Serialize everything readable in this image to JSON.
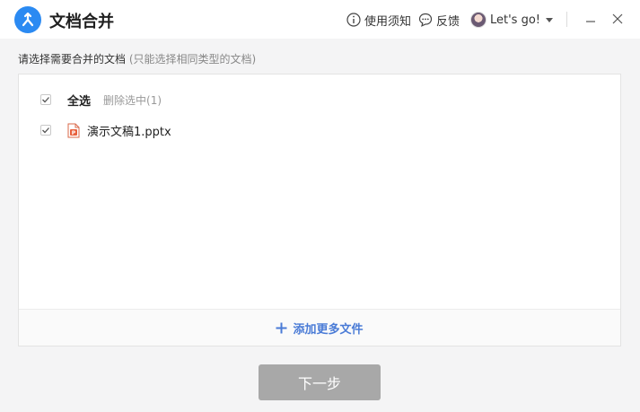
{
  "app": {
    "title": "文档合并",
    "logo_icon": "merge-arrows-icon",
    "brand_color": "#2b8af2"
  },
  "titlebar": {
    "help_label": "使用须知",
    "help_icon": "info-circle-icon",
    "feedback_label": "反馈",
    "feedback_icon": "chat-bubble-icon",
    "user_name": "Let's go!",
    "minimize_icon": "minimize-icon",
    "close_icon": "close-icon"
  },
  "instruction": {
    "text": "请选择需要合并的文档",
    "hint": "(只能选择相同类型的文档)"
  },
  "file_list": {
    "select_all_label": "全选",
    "select_all_checked": true,
    "delete_selected_label": "删除选中(1)",
    "files": [
      {
        "name": "演示文稿1.pptx",
        "checked": true,
        "icon": "powerpoint-file-icon"
      }
    ],
    "add_more_label": "添加更多文件",
    "accent_color": "#4a7bd6"
  },
  "next_button": {
    "label": "下一步",
    "disabled": true
  }
}
